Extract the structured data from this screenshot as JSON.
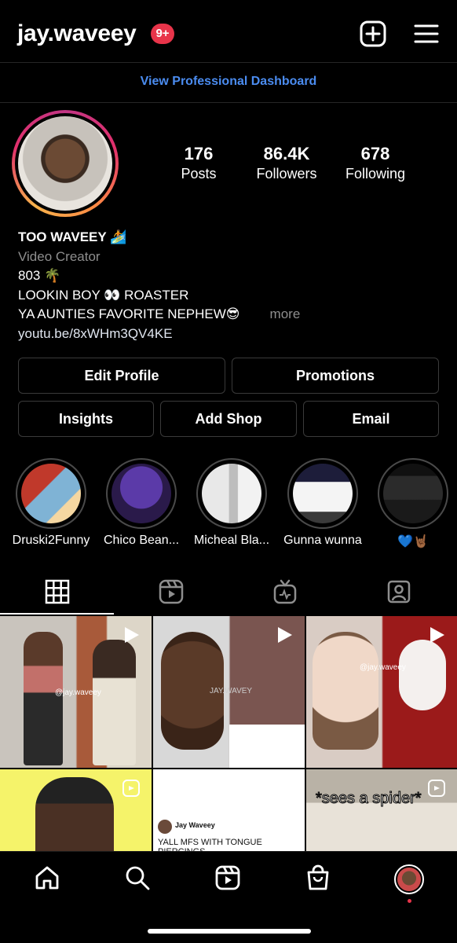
{
  "header": {
    "username": "jay.waveey",
    "notification_count": "9+",
    "icons": [
      "new-post-icon",
      "menu-icon"
    ]
  },
  "pro_dashboard": "View Professional Dashboard",
  "stats": [
    {
      "value": "176",
      "label": "Posts"
    },
    {
      "value": "86.4K",
      "label": "Followers"
    },
    {
      "value": "678",
      "label": "Following"
    }
  ],
  "bio": {
    "name": "TOO WAVEEY 🏄",
    "category": "Video Creator",
    "lines": [
      "803 🌴",
      "LOOKIN BOY 👀 ROASTER",
      "YA AUNTIES FAVORITE NEPHEW😎"
    ],
    "more": "more",
    "link": "youtu.be/8xWHm3QV4KE"
  },
  "buttons": {
    "edit_profile": "Edit Profile",
    "promotions": "Promotions",
    "insights": "Insights",
    "add_shop": "Add Shop",
    "email": "Email"
  },
  "highlights": [
    {
      "label": "Druski2Funny"
    },
    {
      "label": "Chico Bean..."
    },
    {
      "label": "Micheal Bla..."
    },
    {
      "label": "Gunna wunna"
    },
    {
      "label": "💙🤘🏾"
    }
  ],
  "tabs": [
    "grid-icon",
    "reels-icon",
    "igtv-icon",
    "tagged-icon"
  ],
  "grid_text": {
    "watermark1": "@jay.waveey",
    "watermark2": "JAY.WAVEY",
    "watermark3": "@jay.waveey",
    "credit": "jay.waveey",
    "post_author": "Jay Waveey",
    "post_text": "YALL MFS WITH TONGUE PIERCINGS",
    "spider_caption": "*sees a spider*"
  },
  "colors": {
    "background": "#000000",
    "link_blue": "#4b8cf0",
    "badge_red": "#e8344a",
    "muted": "#8e8e8e",
    "border": "#3a3a3a"
  },
  "bottom_nav": [
    "home-icon",
    "search-icon",
    "reels-icon",
    "shop-icon",
    "profile-avatar"
  ]
}
